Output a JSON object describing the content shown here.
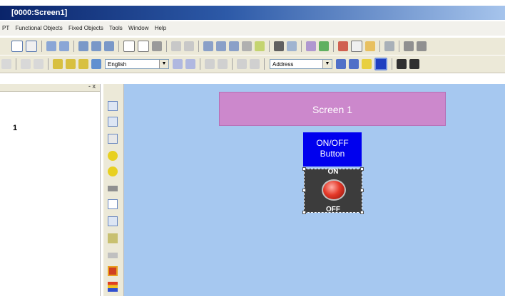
{
  "window": {
    "title": "[0000:Screen1]"
  },
  "menu": [
    "PT",
    "Functional Objects",
    "Fixed Objects",
    "Tools",
    "Window",
    "Help"
  ],
  "toolbar2": {
    "language": "English",
    "address_mode": "Address"
  },
  "left_panel": {
    "close_label": "- x",
    "row_text": "1"
  },
  "canvas": {
    "screen_title": "Screen 1",
    "onoff_button": {
      "line1": "ON/OFF",
      "line2": "Button"
    },
    "switch": {
      "on_label": "ON",
      "off_label": "OFF"
    }
  },
  "colors": {
    "canvas": "#a6c8f0",
    "screen_title_bg": "#cc88cc",
    "onoff_button_bg": "#0000ee",
    "titlebar": "#0a246a"
  }
}
